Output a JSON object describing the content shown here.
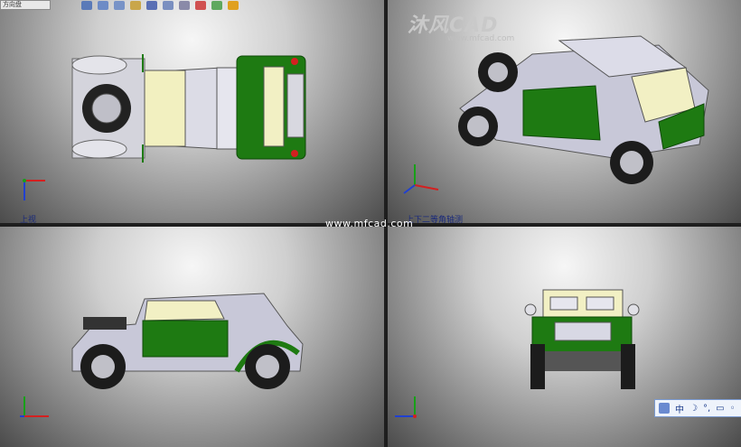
{
  "views": {
    "top_left": {
      "label": "上视"
    },
    "top_right": {
      "label": "上下二等角轴测"
    },
    "bottom_left": {
      "label": ""
    },
    "bottom_right": {
      "label": ""
    }
  },
  "logo": {
    "main": "沐风CAD",
    "site": "www.mfcad.com"
  },
  "watermark": "www.mfcad.com",
  "ime": {
    "items": [
      "中",
      "☽",
      "°,",
      "▭",
      "◦"
    ]
  },
  "colors": {
    "body_gray": "#c8c8d8",
    "body_green": "#1e7a12",
    "roof_cream": "#f2f0c4",
    "axis_red": "#d42020",
    "axis_green": "#18a018",
    "axis_blue": "#2040d0"
  }
}
